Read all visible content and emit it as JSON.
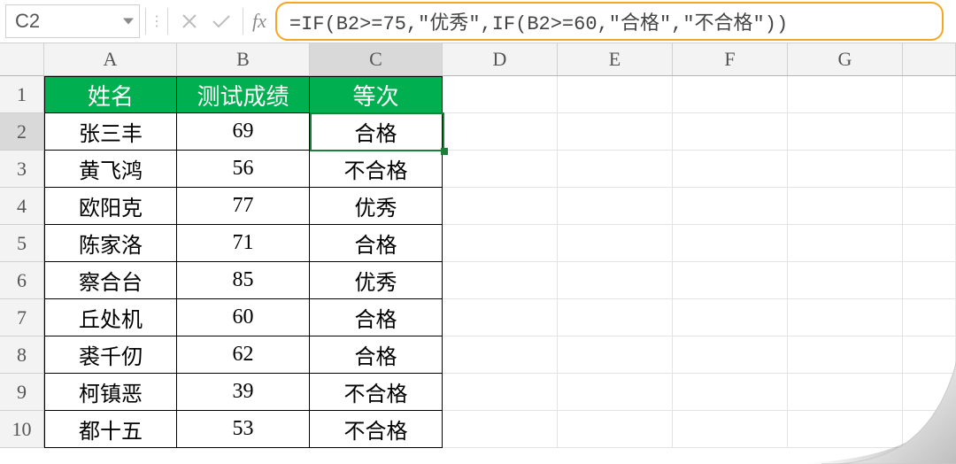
{
  "nameBox": {
    "value": "C2"
  },
  "formulaBar": {
    "fx_label": "fx",
    "formula": "=IF(B2>=75,\"优秀\",IF(B2>=60,\"合格\",\"不合格\"))"
  },
  "columns": [
    "A",
    "B",
    "C",
    "D",
    "E",
    "F",
    "G"
  ],
  "selectedColumnIndex": 2,
  "selectedRowNumber": 2,
  "rows": [
    1,
    2,
    3,
    4,
    5,
    6,
    7,
    8,
    9,
    10
  ],
  "headers": {
    "A": "姓名",
    "B": "测试成绩",
    "C": "等次"
  },
  "data": [
    {
      "name": "张三丰",
      "score": "69",
      "grade": "合格"
    },
    {
      "name": "黄飞鸿",
      "score": "56",
      "grade": "不合格"
    },
    {
      "name": "欧阳克",
      "score": "77",
      "grade": "优秀"
    },
    {
      "name": "陈家洛",
      "score": "71",
      "grade": "合格"
    },
    {
      "name": "察合台",
      "score": "85",
      "grade": "优秀"
    },
    {
      "name": "丘处机",
      "score": "60",
      "grade": "合格"
    },
    {
      "name": "裘千仞",
      "score": "62",
      "grade": "合格"
    },
    {
      "name": "柯镇恶",
      "score": "39",
      "grade": "不合格"
    },
    {
      "name": "都十五",
      "score": "53",
      "grade": "不合格"
    }
  ],
  "colors": {
    "headerBg": "#00b050",
    "selection": "#1a7f37",
    "formulaBorder": "#f5a623"
  }
}
